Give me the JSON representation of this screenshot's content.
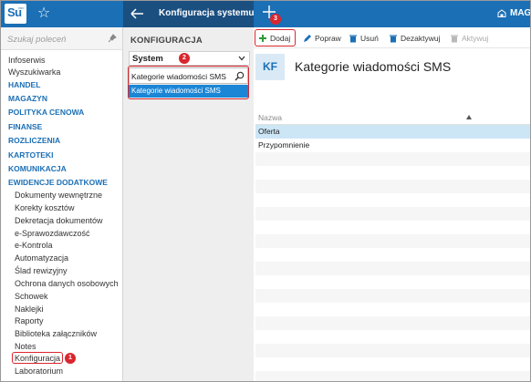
{
  "app": {
    "logo_text": "Su",
    "logo_sub": "PRO",
    "tab_title": "Konfiguracja systemu",
    "company_label": "MAG"
  },
  "sidebar": {
    "search_placeholder": "Szukaj poleceń",
    "items": [
      {
        "label": "Infoserwis",
        "type": "link"
      },
      {
        "label": "Wyszukiwarka",
        "type": "link"
      },
      {
        "label": "HANDEL",
        "type": "category"
      },
      {
        "label": "MAGAZYN",
        "type": "category"
      },
      {
        "label": "POLITYKA CENOWA",
        "type": "category"
      },
      {
        "label": "FINANSE",
        "type": "category"
      },
      {
        "label": "ROZLICZENIA",
        "type": "category"
      },
      {
        "label": "KARTOTEKI",
        "type": "category"
      },
      {
        "label": "KOMUNIKACJA",
        "type": "category"
      },
      {
        "label": "EWIDENCJE DODATKOWE",
        "type": "category"
      },
      {
        "label": "Dokumenty wewnętrzne",
        "type": "sub"
      },
      {
        "label": "Korekty kosztów",
        "type": "sub"
      },
      {
        "label": "Dekretacja dokumentów",
        "type": "sub"
      },
      {
        "label": "e-Sprawozdawczość",
        "type": "sub"
      },
      {
        "label": "e-Kontrola",
        "type": "sub"
      },
      {
        "label": "Automatyzacja",
        "type": "sub"
      },
      {
        "label": "Ślad rewizyjny",
        "type": "sub"
      },
      {
        "label": "Ochrona danych osobowych",
        "type": "sub"
      },
      {
        "label": "Schowek",
        "type": "sub"
      },
      {
        "label": "Naklejki",
        "type": "sub"
      },
      {
        "label": "Raporty",
        "type": "sub"
      },
      {
        "label": "Biblioteka załączników",
        "type": "sub"
      },
      {
        "label": "Notes",
        "type": "sub"
      },
      {
        "label": "Konfiguracja",
        "type": "sub",
        "highlighted": true
      },
      {
        "label": "Laboratorium",
        "type": "sub"
      }
    ]
  },
  "config_panel": {
    "title": "KONFIGURACJA",
    "select_value": "System",
    "search_value": "Kategorie wiadomości SMS",
    "result_item": "Kategorie wiadomości SMS"
  },
  "toolbar": {
    "add": "Dodaj",
    "edit": "Popraw",
    "delete": "Usuń",
    "deactivate": "Dezaktywuj",
    "activate": "Aktywuj"
  },
  "main": {
    "icon_text": "KF",
    "title": "Kategorie wiadomości SMS",
    "column_header": "Nazwa",
    "rows": [
      "Oferta",
      "Przypomnienie"
    ],
    "selected_row": 0
  },
  "callouts": [
    "1",
    "2",
    "3"
  ],
  "colors": {
    "brand_blue": "#1b6fb5",
    "dark_blue": "#1a4f80",
    "highlight_red": "#d9262e",
    "selection_blue": "#1b86d6",
    "add_green": "#2e9a3a"
  }
}
